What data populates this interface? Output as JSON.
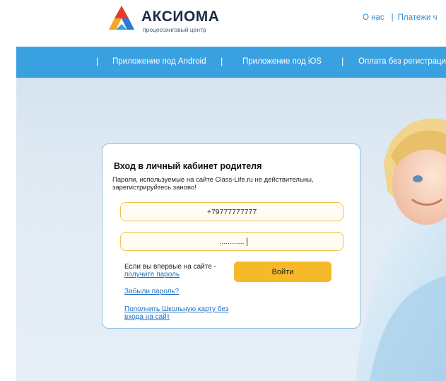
{
  "header": {
    "logo": {
      "title": "АКСИОМА",
      "subtitle": "процессинговый центр",
      "icon": "axioma-logo-icon"
    },
    "nav": [
      {
        "label": "О нас"
      },
      {
        "label": "Платежи ч"
      }
    ]
  },
  "bluebar": {
    "items": [
      {
        "label": "Приложение под Android"
      },
      {
        "label": "Приложение под iOS"
      },
      {
        "label": "Оплата без регистраци"
      }
    ]
  },
  "login": {
    "title": "Вход в личный кабинет родителя",
    "note": "Пароли, используемые на сайте Class-Life.ru не действительны, зарегистрируйтесь заново!",
    "phone_value": "+79777777777",
    "password_value": "............",
    "first_visit": "Если вы впервые на сайте -",
    "get_password": "получите пароль",
    "submit": "Войти",
    "forgot": "Забыли пароль?",
    "topup": "Пополнить Школьную карту без входа на сайт"
  },
  "colors": {
    "accent_blue": "#3aa1e0",
    "button_yellow": "#f7b928",
    "field_border": "#f2c14d",
    "link": "#1f6fbf"
  }
}
